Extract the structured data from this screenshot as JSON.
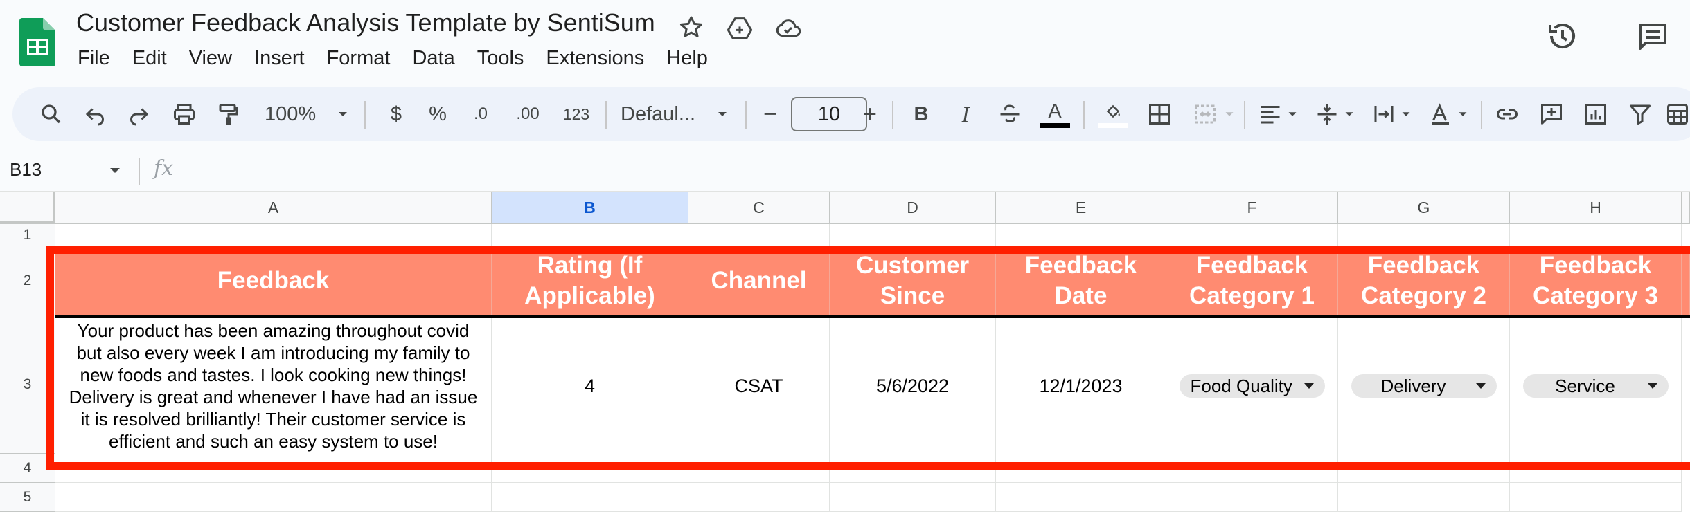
{
  "app": {
    "doc_title": "Customer Feedback Analysis Template by SentiSum",
    "menu": [
      "File",
      "Edit",
      "View",
      "Insert",
      "Format",
      "Data",
      "Tools",
      "Extensions",
      "Help"
    ],
    "brand_color": "#0f9d58"
  },
  "toolbar": {
    "zoom": "100%",
    "currency": "$",
    "percent": "%",
    "decrease_decimal": ".0",
    "increase_decimal": ".00",
    "number_format": "123",
    "font": "Defaul...",
    "font_size": "10",
    "minus": "−",
    "plus": "+",
    "bold": "B",
    "italic": "I",
    "text_color_letter": "A"
  },
  "formula_bar": {
    "cell_ref": "B13",
    "fx": "fx"
  },
  "sheet": {
    "columns": [
      "A",
      "B",
      "C",
      "D",
      "E",
      "F",
      "G",
      "H"
    ],
    "selected_column": "B",
    "rows": [
      "1",
      "2",
      "3",
      "4",
      "5"
    ],
    "headers": {
      "a": "Feedback",
      "b": "Rating (If Applicable)",
      "c": "Channel",
      "d": "Customer Since",
      "e": "Feedback Date",
      "f": "Feedback Category 1",
      "g": "Feedback Category 2",
      "h": "Feedback Category 3"
    },
    "row3": {
      "feedback": "Your product has been amazing throughout covid but also every week I am introducing my family to new foods and tastes. I look cooking new things! Delivery is great and whenever I have had an issue it is resolved brilliantly! Their customer service is efficient and such an easy system to use!",
      "rating": "4",
      "channel": "CSAT",
      "customer_since": "5/6/2022",
      "feedback_date": "12/1/2023",
      "category1": "Food Quality",
      "category2": "Delivery",
      "category3": "Service"
    },
    "header_color": "#ff8b71",
    "highlight_color": "#ff1f00"
  }
}
